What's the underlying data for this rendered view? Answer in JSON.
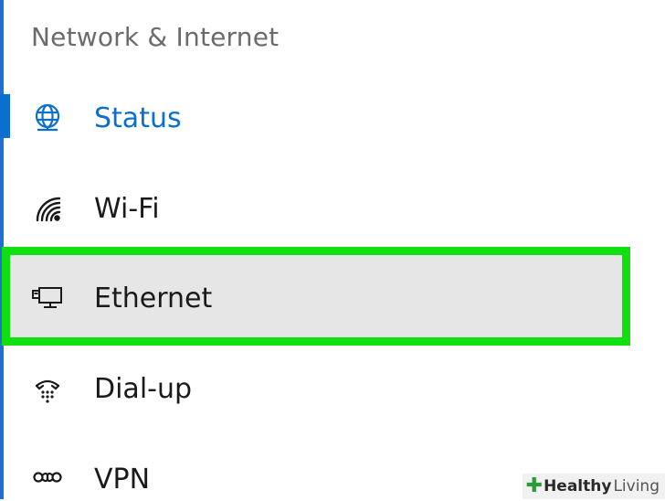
{
  "section": {
    "title": "Network & Internet"
  },
  "nav": {
    "items": [
      {
        "label": "Status",
        "icon": "globe-icon",
        "active": true
      },
      {
        "label": "Wi-Fi",
        "icon": "wifi-icon",
        "active": false
      },
      {
        "label": "Ethernet",
        "icon": "ethernet-icon",
        "active": false,
        "highlighted": true
      },
      {
        "label": "Dial-up",
        "icon": "dialup-icon",
        "active": false
      },
      {
        "label": "VPN",
        "icon": "vpn-icon",
        "active": false
      }
    ]
  },
  "colors": {
    "accent": "#0a6fd0",
    "highlight_border": "#10e010",
    "highlight_fill": "#e6e6e6",
    "text": "#1a1a1a",
    "muted": "#6b6b6b"
  },
  "watermark": {
    "brand_bold": "Healthy",
    "brand_light": "Living"
  }
}
